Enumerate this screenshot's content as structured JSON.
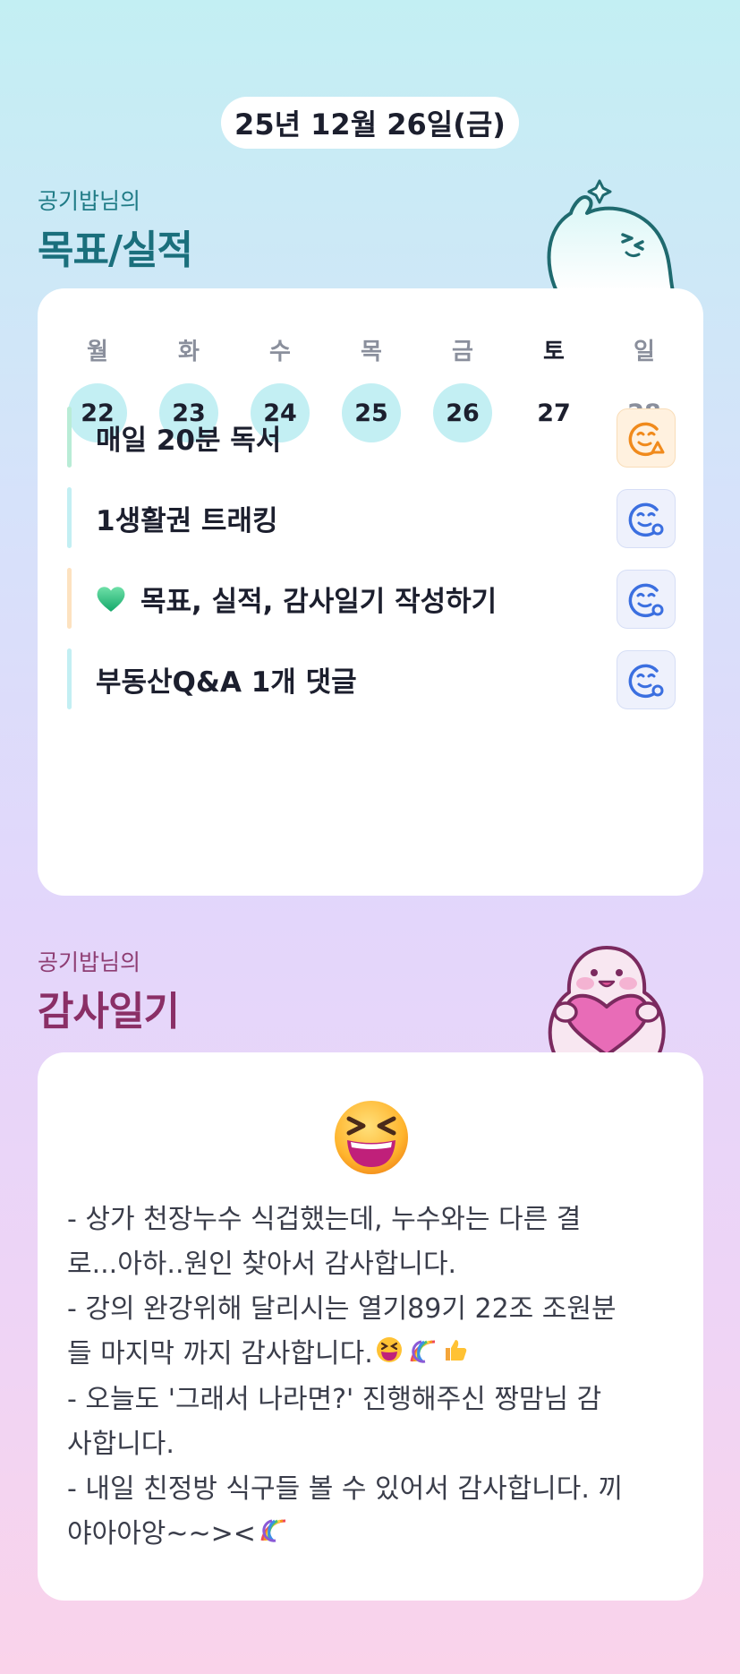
{
  "date_label": "25년 12월 26일(금)",
  "goal_section": {
    "subtitle": "공기밥님의",
    "title": "목표/실적",
    "week": [
      {
        "day": "월",
        "date": "22",
        "done": true
      },
      {
        "day": "화",
        "date": "23",
        "done": true
      },
      {
        "day": "수",
        "date": "24",
        "done": true
      },
      {
        "day": "목",
        "date": "25",
        "done": true
      },
      {
        "day": "금",
        "date": "26",
        "done": true
      },
      {
        "day": "토",
        "date": "27",
        "done": false
      },
      {
        "day": "일",
        "date": "28",
        "done": false
      }
    ],
    "goals": [
      {
        "label": "매일 20분 독서",
        "bar_color": "#b9ecd6",
        "status": "warning",
        "status_icon": "face-warning-icon"
      },
      {
        "label": "1생활권 트래킹",
        "bar_color": "#c3eff3",
        "status": "done",
        "status_icon": "face-done-icon"
      },
      {
        "label": "목표, 실적, 감사일기 작성하기",
        "emoji": "green-heart-icon",
        "bar_color": "#fde2c0",
        "status": "done",
        "status_icon": "face-done-icon"
      },
      {
        "label": "부동산Q&A 1개 댓글",
        "bar_color": "#c3eff3",
        "status": "done",
        "status_icon": "face-done-icon"
      }
    ]
  },
  "diary_section": {
    "subtitle": "공기밥님의",
    "title": "감사일기",
    "mood_icon": "grinning-squinting-face-icon",
    "lines": [
      "- 상가 천장누수 식겁했는데, 누수와는 다른 결",
      "로...아하..원인 찾아서 감사합니다.",
      "- 강의 완강위해 달리시는 열기89기 22조 조원분",
      "들 마지막 까지 감사합니다.",
      "- 오늘도 '그래서 나라면?' 진행해주신 짱맘님 감",
      "사합니다.",
      "- 내일 친정방 식구들 볼 수 있어서 감사합니다. 끼",
      "야아아앙~~><"
    ]
  },
  "colors": {
    "done_circle": "#c3eff3",
    "goal_title": "#1a6f7c",
    "diary_title": "#8a2f66",
    "warning_face": "#f08a1c",
    "done_face": "#3b6fe0"
  }
}
